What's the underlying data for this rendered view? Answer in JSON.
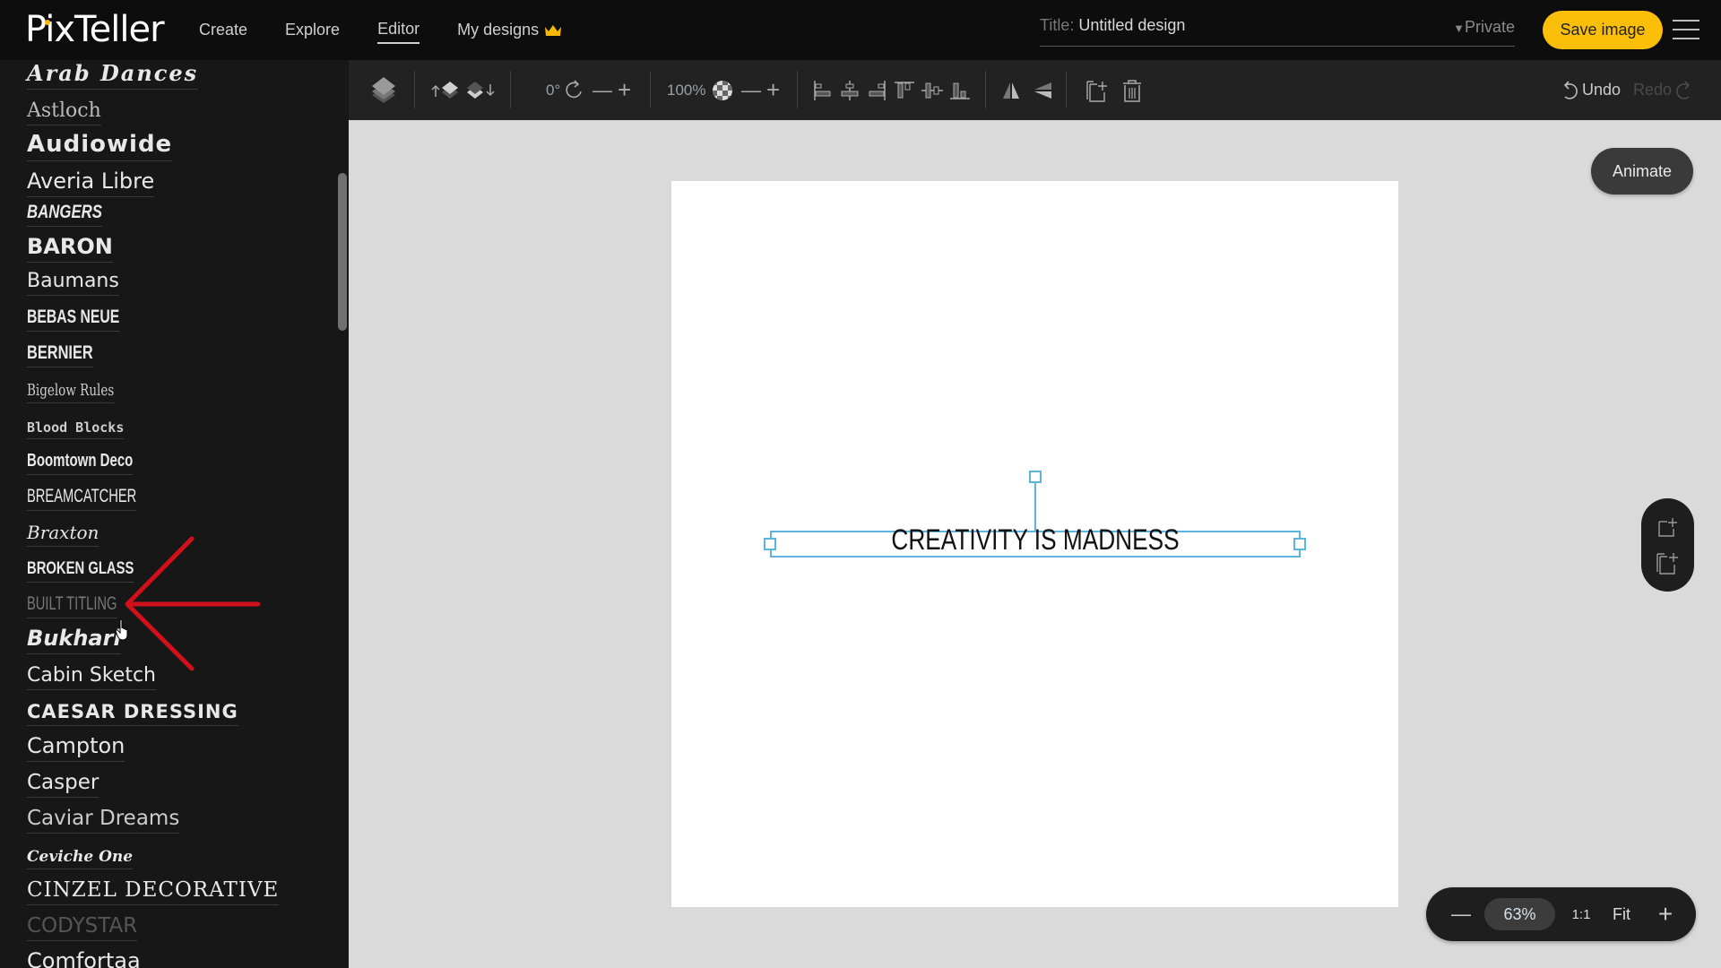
{
  "app": {
    "logo": "PixTeller",
    "nav": [
      {
        "label": "Create",
        "active": false
      },
      {
        "label": "Explore",
        "active": false
      },
      {
        "label": "Editor",
        "active": true
      },
      {
        "label": "My designs",
        "active": false,
        "icon": "crown-icon"
      }
    ],
    "title_label": "Title:",
    "title_value": "Untitled design",
    "privacy": "Private",
    "save_label": "Save image",
    "brand_color": "#fbbf0a"
  },
  "toolbar": {
    "rotation": "0°",
    "opacity": "100%",
    "undo_label": "Undo",
    "redo_label": "Redo"
  },
  "sidebar": {
    "fonts": [
      "Arab Dances",
      "Astloch",
      "Audiowide",
      "Averia Libre",
      "BANGERS",
      "BARON",
      "Baumans",
      "BEBAS NEUE",
      "BERNIER",
      "Bigelow Rules",
      "Blood Blocks",
      "Boomtown Deco",
      "BREAMCATCHER",
      "Braxton",
      "BROKEN GLASS",
      "BUILT TITLING",
      "Bukhari",
      "Cabin Sketch",
      "CAESAR DRESSING",
      "Campton",
      "Casper",
      "Caviar Dreams",
      "Ceviche One",
      "CINZEL DECORATIVE",
      "CODYSTAR",
      "Comfortaa"
    ],
    "highlighted_font": "BUILT TITLING"
  },
  "canvas": {
    "text": "CREATIVITY IS MADNESS",
    "selection_color": "#5bb5e0"
  },
  "animate_label": "Animate",
  "zoom": {
    "value": "63%",
    "one_to_one": "1:1",
    "fit": "Fit"
  },
  "annotation_color": "#d0101a"
}
